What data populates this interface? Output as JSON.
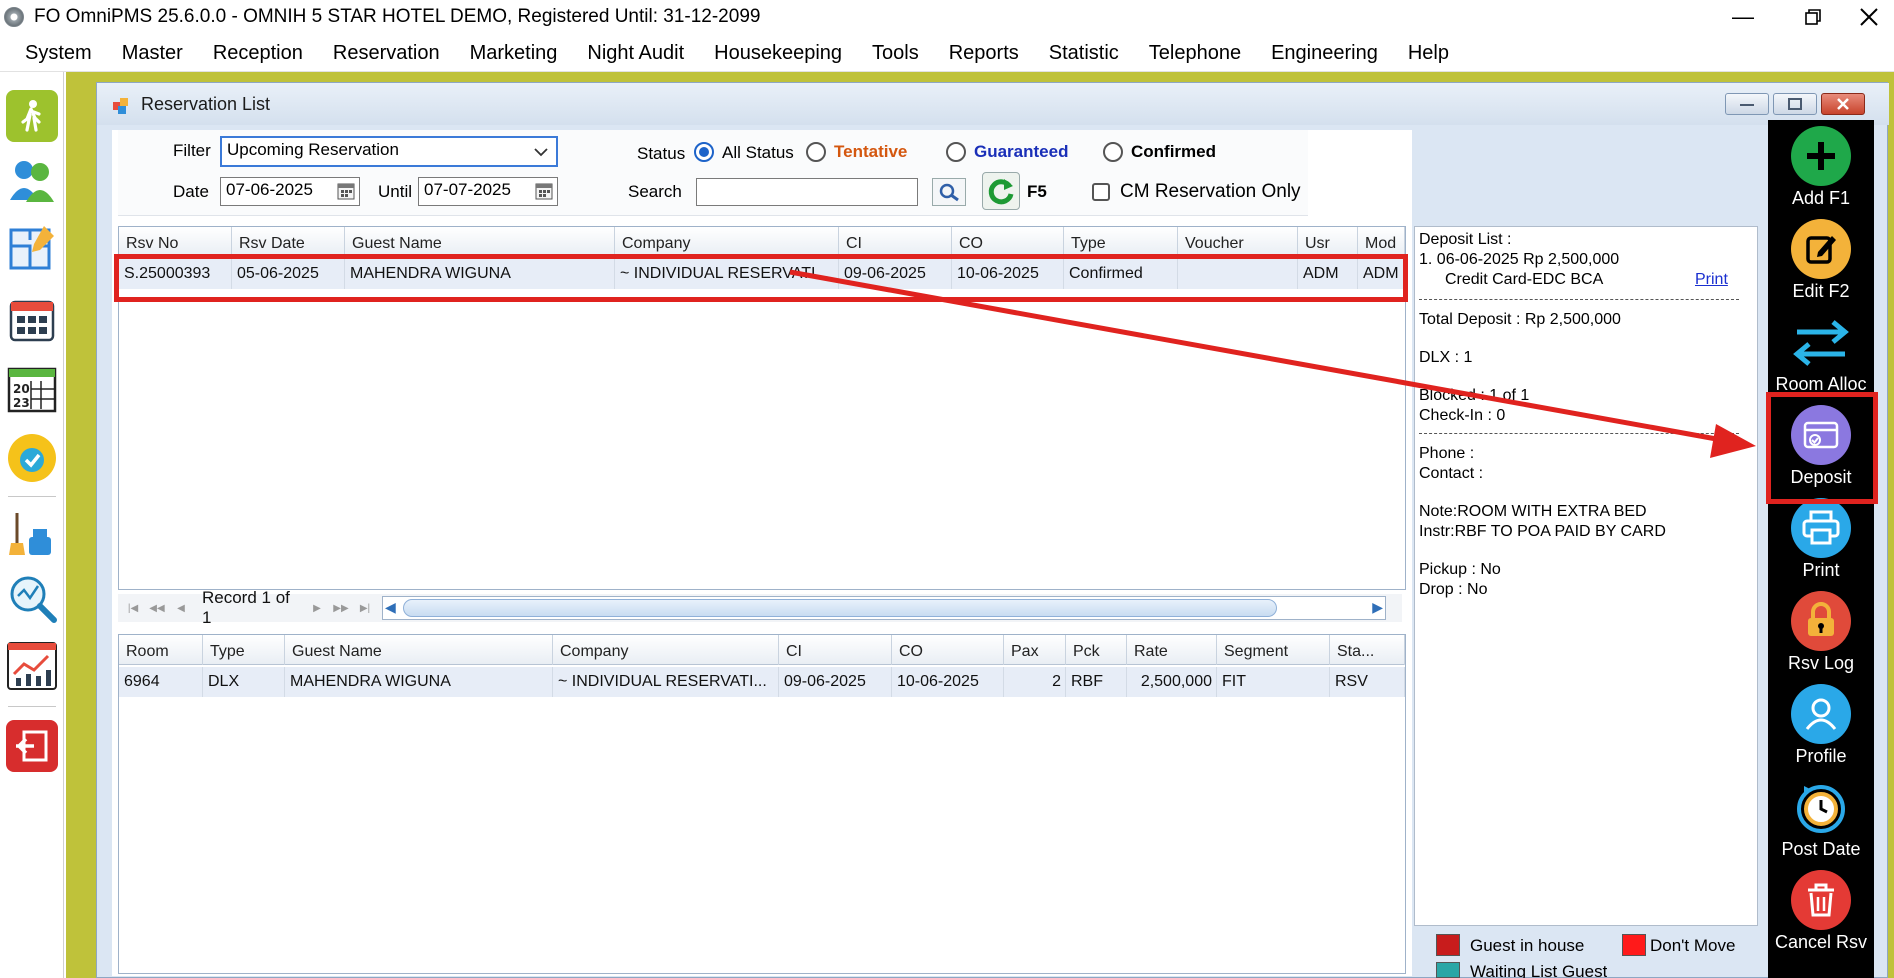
{
  "window": {
    "title": "FO OmniPMS 25.6.0.0 - OMNIH 5 STAR HOTEL DEMO, Registered Until: 31-12-2099"
  },
  "menu": [
    "System",
    "Master",
    "Reception",
    "Reservation",
    "Marketing",
    "Night Audit",
    "Housekeeping",
    "Tools",
    "Reports",
    "Statistic",
    "Telephone",
    "Engineering",
    "Help"
  ],
  "left_toolbar": [
    "walk-in-icon",
    "guests-icon",
    "floor-plan-icon",
    "calendar-grid-icon",
    "calendar-2023-icon",
    "availability-icon",
    "housekeeping-icon",
    "search-analytics-icon",
    "statistics-chart-icon",
    "exit-icon"
  ],
  "child_window": {
    "title": "Reservation List"
  },
  "filter": {
    "filter_label": "Filter",
    "filter_value": "Upcoming Reservation",
    "date_label": "Date",
    "date_value": "07-06-2025",
    "until_label": "Until",
    "until_value": "07-07-2025",
    "status_label": "Status",
    "status_options": [
      "All Status",
      "Tentative",
      "Guaranteed",
      "Confirmed"
    ],
    "status_selected": "All Status",
    "search_label": "Search",
    "search_value": "",
    "refresh_label": "F5",
    "cm_only_label": "CM Reservation Only",
    "cm_only_checked": false
  },
  "reservations": {
    "columns": [
      "Rsv No",
      "Rsv Date",
      "Guest Name",
      "Company",
      "CI",
      "CO",
      "Type",
      "Voucher",
      "Usr",
      "Mod"
    ],
    "rows": [
      [
        "S.25000393",
        "05-06-2025",
        "MAHENDRA WIGUNA",
        "~ INDIVIDUAL RESERVATI...",
        "09-06-2025",
        "10-06-2025",
        "Confirmed",
        "",
        "ADM",
        "ADM"
      ]
    ],
    "record_text": "Record 1 of 1"
  },
  "rooms": {
    "columns": [
      "Room",
      "Type",
      "Guest Name",
      "Company",
      "CI",
      "CO",
      "Pax",
      "Pck",
      "Rate",
      "Segment",
      "Sta..."
    ],
    "rows": [
      [
        "6964",
        "DLX",
        "MAHENDRA WIGUNA",
        "~ INDIVIDUAL RESERVATI...",
        "09-06-2025",
        "10-06-2025",
        "2",
        "RBF",
        "2,500,000",
        "FIT",
        "RSV"
      ]
    ]
  },
  "info": {
    "deposit_header": "Deposit List :",
    "deposit_line": "1. 06-06-2025   Rp 2,500,000",
    "deposit_method": "Credit Card-EDC BCA",
    "print_link": "Print",
    "total_deposit": "Total Deposit : Rp 2,500,000",
    "room_type_count": "DLX : 1",
    "blocked": "Blocked : 1 of 1",
    "checkin": "Check-In : 0",
    "phone": "Phone :",
    "contact": "Contact :",
    "note": "Note:ROOM WITH EXTRA BED",
    "instr": "Instr:RBF TO POA PAID BY CARD",
    "pickup": "Pickup : No",
    "drop": "Drop : No"
  },
  "legend": [
    {
      "label": "Guest in house",
      "color": "#c81c1c"
    },
    {
      "label": "Don't Move",
      "color": "#ff1a1a"
    },
    {
      "label": "Waiting List Guest",
      "color": "#2aa6a6"
    }
  ],
  "actions": [
    {
      "label": "Add F1",
      "icon": "add-icon",
      "color": "#1fa84a"
    },
    {
      "label": "Edit F2",
      "icon": "edit-icon",
      "color": "#f3b23a"
    },
    {
      "label": "Room Alloc",
      "icon": "room-alloc-icon",
      "color": "#000000"
    },
    {
      "label": "Deposit",
      "icon": "deposit-icon",
      "color": "#8b78e0"
    },
    {
      "label": "Print",
      "icon": "print-icon",
      "color": "#2aa8e8"
    },
    {
      "label": "Rsv Log",
      "icon": "lock-icon",
      "color": "#e04a3a"
    },
    {
      "label": "Profile",
      "icon": "profile-icon",
      "color": "#2aa8e8"
    },
    {
      "label": "Post Date",
      "icon": "post-date-icon",
      "color": "#ffffff"
    },
    {
      "label": "Cancel Rsv",
      "icon": "trash-icon",
      "color": "#e43a35"
    }
  ],
  "colors": {
    "accent_red": "#e0231f",
    "olive_frame": "#bfc23a",
    "tentative_text": "#d4570f",
    "guaranteed_text": "#1a2fb8"
  }
}
